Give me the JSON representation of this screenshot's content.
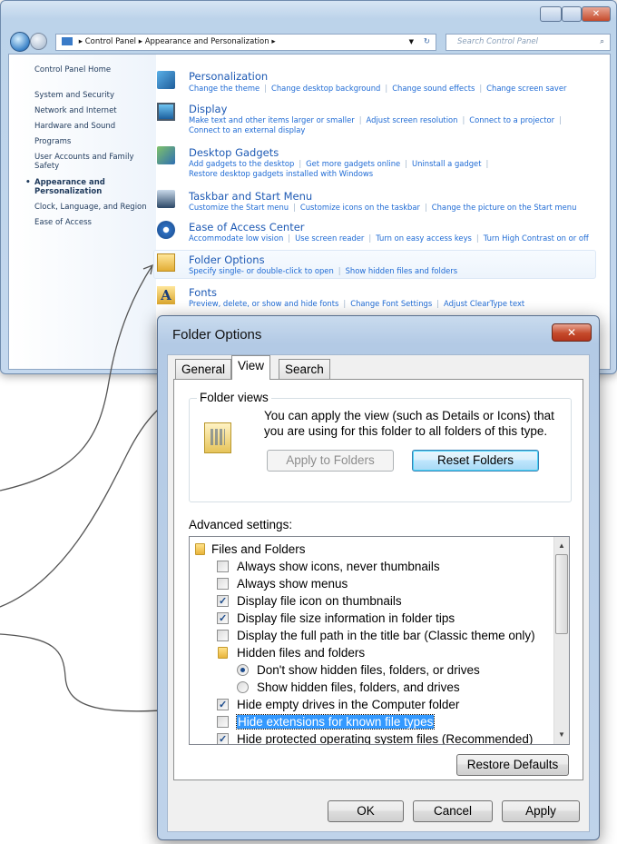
{
  "control_panel": {
    "breadcrumb": [
      "Control Panel",
      "Appearance and Personalization"
    ],
    "search_placeholder": "Search Control Panel",
    "nav": {
      "home": "Control Panel Home",
      "items": [
        "System and Security",
        "Network and Internet",
        "Hardware and Sound",
        "Programs",
        "User Accounts and Family Safety",
        "Appearance and Personalization",
        "Clock, Language, and Region",
        "Ease of Access"
      ],
      "active_index": 5
    },
    "categories": [
      {
        "title": "Personalization",
        "links": [
          "Change the theme",
          "Change desktop background",
          "Change sound effects",
          "Change screen saver"
        ]
      },
      {
        "title": "Display",
        "links": [
          "Make text and other items larger or smaller",
          "Adjust screen resolution",
          "Connect to a projector",
          "Connect to an external display"
        ]
      },
      {
        "title": "Desktop Gadgets",
        "links": [
          "Add gadgets to the desktop",
          "Get more gadgets online",
          "Uninstall a gadget",
          "Restore desktop gadgets installed with Windows"
        ]
      },
      {
        "title": "Taskbar and Start Menu",
        "links": [
          "Customize the Start menu",
          "Customize icons on the taskbar",
          "Change the picture on the Start menu"
        ]
      },
      {
        "title": "Ease of Access Center",
        "links": [
          "Accommodate low vision",
          "Use screen reader",
          "Turn on easy access keys",
          "Turn High Contrast on or off"
        ]
      },
      {
        "title": "Folder Options",
        "links": [
          "Specify single- or double-click to open",
          "Show hidden files and folders"
        ]
      },
      {
        "title": "Fonts",
        "links": [
          "Preview, delete, or show and hide fonts",
          "Change Font Settings",
          "Adjust ClearType text"
        ]
      }
    ]
  },
  "dialog": {
    "title": "Folder Options",
    "tabs": [
      "General",
      "View",
      "Search"
    ],
    "active_tab": "View",
    "folder_views": {
      "label": "Folder views",
      "text": "You can apply the view (such as Details or Icons) that you are using for this folder to all folders of this type.",
      "apply_button": "Apply to Folders",
      "reset_button": "Reset Folders"
    },
    "advanced_label": "Advanced settings:",
    "tree": [
      {
        "type": "folder",
        "label": "Files and Folders",
        "indent": 0
      },
      {
        "type": "checkbox",
        "label": "Always show icons, never thumbnails",
        "checked": false,
        "indent": 1
      },
      {
        "type": "checkbox",
        "label": "Always show menus",
        "checked": false,
        "indent": 1
      },
      {
        "type": "checkbox",
        "label": "Display file icon on thumbnails",
        "checked": true,
        "indent": 1
      },
      {
        "type": "checkbox",
        "label": "Display file size information in folder tips",
        "checked": true,
        "indent": 1
      },
      {
        "type": "checkbox",
        "label": "Display the full path in the title bar (Classic theme only)",
        "checked": false,
        "indent": 1
      },
      {
        "type": "folder",
        "label": "Hidden files and folders",
        "indent": 1
      },
      {
        "type": "radio",
        "label": "Don't show hidden files, folders, or drives",
        "checked": true,
        "indent": 2
      },
      {
        "type": "radio",
        "label": "Show hidden files, folders, and drives",
        "checked": false,
        "indent": 2
      },
      {
        "type": "checkbox",
        "label": "Hide empty drives in the Computer folder",
        "checked": true,
        "indent": 1
      },
      {
        "type": "checkbox",
        "label": "Hide extensions for known file types",
        "checked": false,
        "indent": 1,
        "selected": true
      },
      {
        "type": "checkbox",
        "label": "Hide protected operating system files (Recommended)",
        "checked": true,
        "indent": 1
      }
    ],
    "restore_defaults": "Restore Defaults",
    "ok": "OK",
    "cancel": "Cancel",
    "apply": "Apply"
  }
}
